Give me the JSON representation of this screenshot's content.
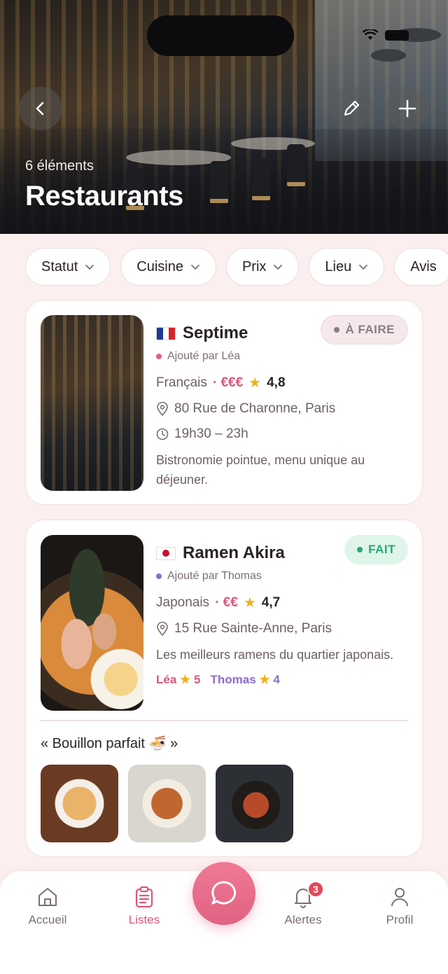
{
  "hero": {
    "count": "6 éléments",
    "title": "Restaurants"
  },
  "filters": [
    {
      "label": "Statut"
    },
    {
      "label": "Cuisine"
    },
    {
      "label": "Prix"
    },
    {
      "label": "Lieu"
    },
    {
      "label": "Avis"
    }
  ],
  "items": [
    {
      "name": "Septime",
      "flag": "fr",
      "added_by": "Ajouté par Léa",
      "added_dot_color": "#e0607f",
      "cuisine": "Français",
      "price": "· €€€",
      "rating": "4,8",
      "address": "80 Rue de Charonne, Paris",
      "hours": "19h30 – 23h",
      "description": "Bistronomie pointue, menu unique au déjeuner.",
      "status": "À FAIRE"
    },
    {
      "name": "Ramen Akira",
      "flag": "jp",
      "added_by": "Ajouté par Thomas",
      "added_dot_color": "#8b6cc9",
      "cuisine": "Japonais",
      "price": "· €€",
      "rating": "4,7",
      "address": "15 Rue Sainte-Anne, Paris",
      "description": "Les meilleurs ramens du quartier japonais.",
      "status": "FAIT",
      "user_ratings": [
        {
          "user": "Léa",
          "score": "5",
          "color": "#d9587a"
        },
        {
          "user": "Thomas",
          "score": "4",
          "color": "#8b6cc9"
        }
      ],
      "quote": "« Bouillon parfait 🍜 »"
    }
  ],
  "tabbar": {
    "home": "Accueil",
    "lists": "Listes",
    "alerts": "Alertes",
    "alerts_badge": "3",
    "profile": "Profil"
  },
  "colors": {
    "accent": "#d9587a",
    "background": "#fbf0ef",
    "done": "#2aa770"
  }
}
